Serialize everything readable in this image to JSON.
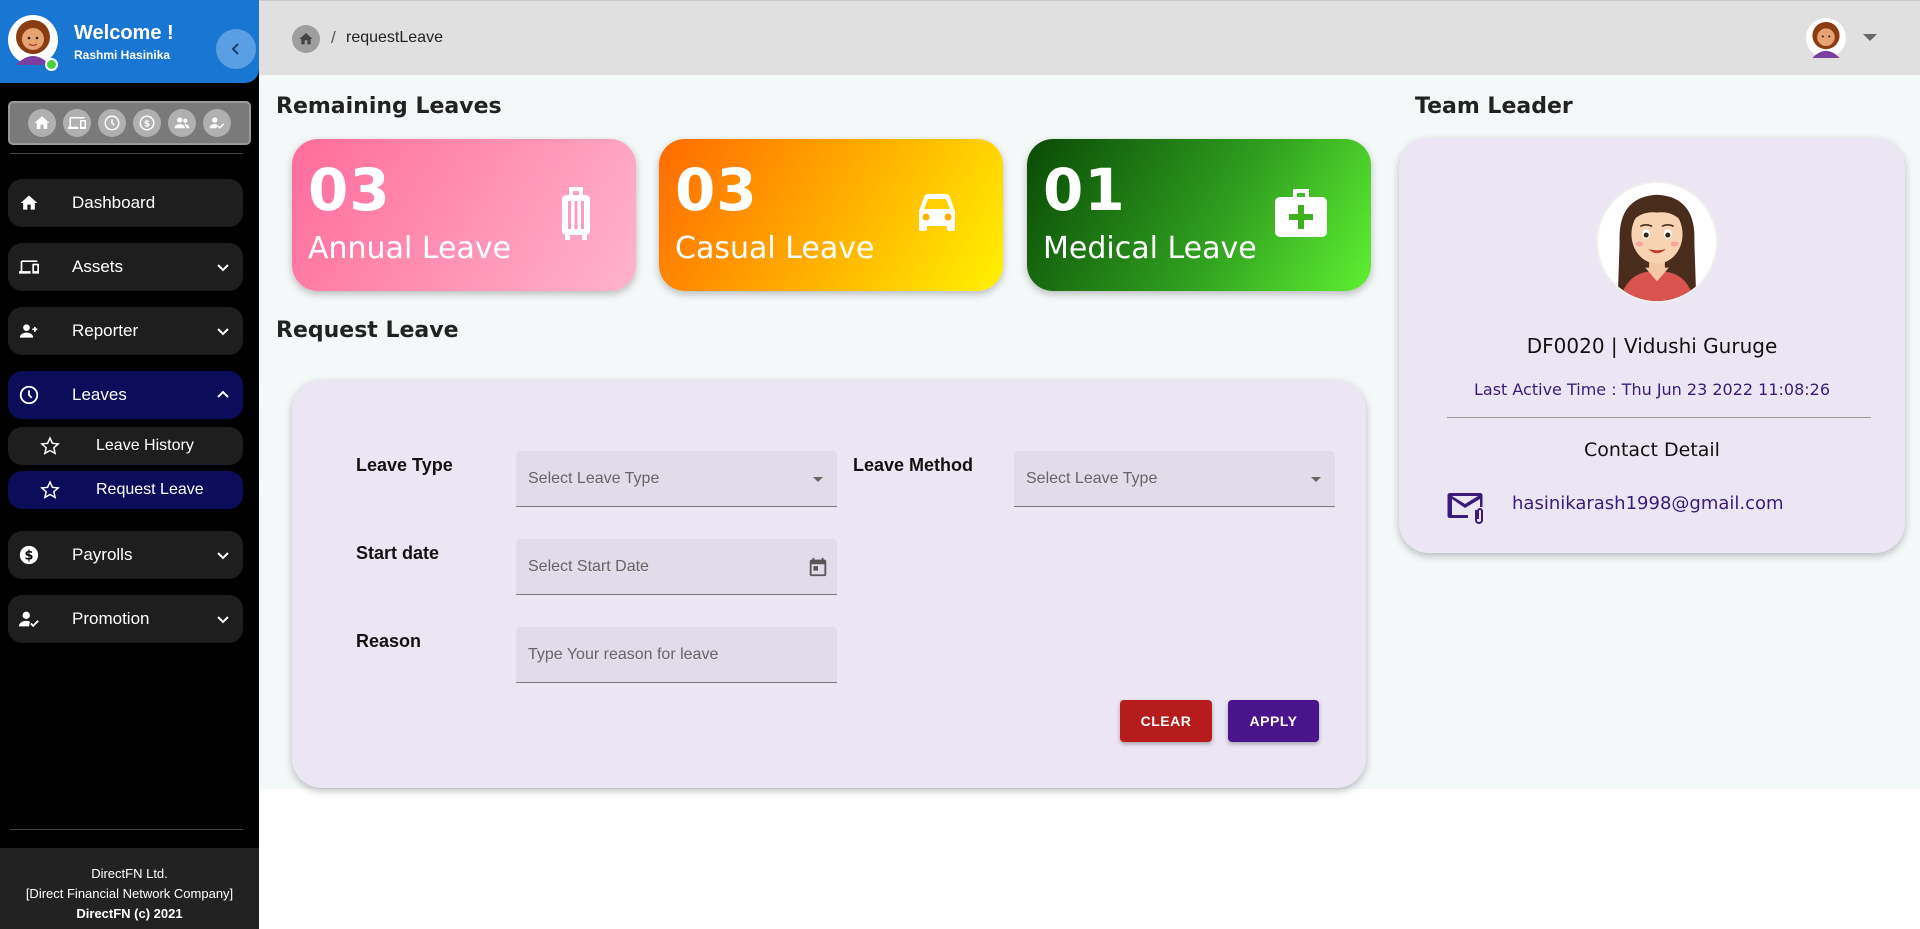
{
  "colors": {
    "sidebar_bg": "#000000",
    "profile_bg": "#1976d2",
    "active_nav": "#0b0c5a",
    "clear_btn": "#b71c1c",
    "apply_btn": "#4a148c",
    "annual": "#ff6c9b",
    "casual": "#ffb300",
    "medical": "#2f9d1f"
  },
  "profile": {
    "welcome": "Welcome !",
    "name": "Rashmi Hasinika"
  },
  "quickbar": [
    "home-icon",
    "devices-icon",
    "clock-icon",
    "dollar-icon",
    "people-icon",
    "user-check-icon"
  ],
  "nav": {
    "dashboard": "Dashboard",
    "assets": "Assets",
    "reporter": "Reporter",
    "leaves": "Leaves",
    "leave_history": "Leave History",
    "request_leave": "Request Leave",
    "payrolls": "Payrolls",
    "promotion": "Promotion"
  },
  "footer": {
    "line1": "DirectFN Ltd.",
    "line2": "[Direct Financial Network Company]",
    "line3": "DirectFN (c) 2021"
  },
  "breadcrumb": {
    "separator": "/",
    "current": "requestLeave"
  },
  "remaining": {
    "title": "Remaining Leaves",
    "cards": [
      {
        "count": "03",
        "name": "Annual Leave",
        "icon": "luggage-icon"
      },
      {
        "count": "03",
        "name": "Casual Leave",
        "icon": "car-icon"
      },
      {
        "count": "01",
        "name": "Medical Leave",
        "icon": "medical-kit-icon"
      }
    ]
  },
  "request": {
    "title": "Request Leave",
    "leave_type_label": "Leave Type",
    "leave_type_placeholder": "Select Leave Type",
    "leave_method_label": "Leave Method",
    "leave_method_placeholder": "Select Leave Type",
    "start_date_label": "Start date",
    "start_date_placeholder": "Select Start Date",
    "reason_label": "Reason",
    "reason_placeholder": "Type Your reason for leave",
    "clear": "CLEAR",
    "apply": "APPLY"
  },
  "leader": {
    "title": "Team Leader",
    "name": "DF0020 | Vidushi Guruge",
    "last_active": "Last Active Time : Thu Jun 23 2022 11:08:26",
    "contact_title": "Contact Detail",
    "email": "hasinikarash1998@gmail.com"
  }
}
